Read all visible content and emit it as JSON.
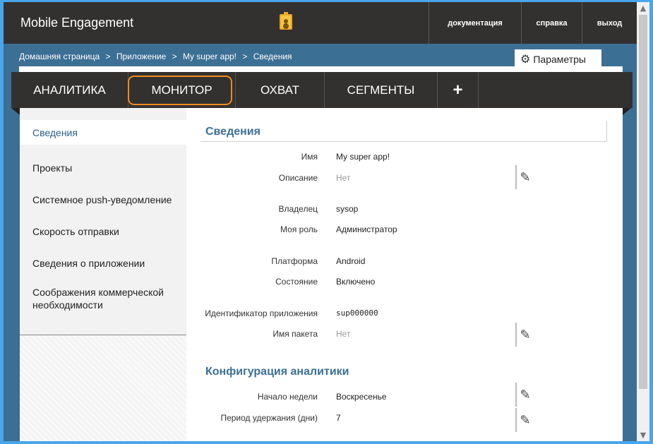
{
  "header": {
    "brand": "Mobile Engagement",
    "links": [
      "документация",
      "справка",
      "выход"
    ]
  },
  "breadcrumb": [
    "Домашняя страница",
    ">",
    "Приложение",
    ">",
    "My super app!",
    ">",
    "Сведения"
  ],
  "params_button": "Параметры",
  "tabs": [
    "АНАЛИТИКА",
    "МОНИТОР",
    "ОХВАТ",
    "СЕГМЕНТЫ",
    "+"
  ],
  "sidebar": {
    "items": [
      "Сведения",
      "Проекты",
      "Системное push-уведомление",
      "Скорость отправки",
      "Сведения о приложении",
      "Соображения коммерческой необходимости"
    ]
  },
  "details": {
    "title": "Сведения",
    "rows": [
      {
        "label": "Имя",
        "value": "My super app!"
      },
      {
        "label": "Описание",
        "value": "Нет"
      },
      {
        "label": "Владелец",
        "value": "sysop"
      },
      {
        "label": "Моя роль",
        "value": "Администратор"
      },
      {
        "label": "Платформа",
        "value": "Android"
      },
      {
        "label": "Состояние",
        "value": "Включено"
      },
      {
        "label": "Идентификатор приложения",
        "value": "sup000000"
      },
      {
        "label": "Имя пакета",
        "value": "Нет"
      }
    ]
  },
  "analytics_config": {
    "title": "Конфигурация аналитики",
    "rows": [
      {
        "label": "Начало недели",
        "value": "Воскресенье"
      },
      {
        "label": "Период удержания (дни)",
        "value": "7"
      }
    ]
  },
  "colors": {
    "accent": "#3c6f94",
    "highlight": "#f08a1d",
    "dark": "#333130"
  }
}
